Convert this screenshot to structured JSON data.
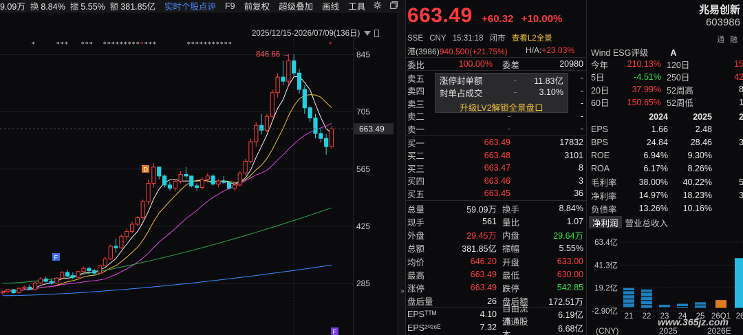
{
  "colors": {
    "up": "#ff3b3b",
    "down": "#2ee04a",
    "accent": "#f0c23a",
    "active_tab": "#4d8dff"
  },
  "toolbar": {
    "vol_text": "9.09万",
    "turnover_label": "换",
    "turnover_value": "8.84%",
    "amplitude_label": "振",
    "amplitude_value": "5.55%",
    "amount_label": "额",
    "amount_value": "381.85亿",
    "buttons": [
      "实时个股点评",
      "F9",
      "前复权",
      "超级叠加",
      "画线",
      "工具"
    ],
    "settings_icon": "gear-icon",
    "window_icon": "restore-window-icon"
  },
  "chart": {
    "date_range": "2025/12/15-2026/07/09(136日)",
    "peak_label": "846.66",
    "current_price_tag": "663.49",
    "y_ticks": [
      "845",
      "705",
      "565",
      "425",
      "285"
    ],
    "marker_D": "D",
    "marker_F": "F"
  },
  "chart_data": {
    "type": "candlestick",
    "y_ticks": [
      845,
      705,
      565,
      425,
      285
    ],
    "peak": 846.66,
    "last_close": 663.49,
    "series": [
      {
        "name": "K线",
        "ohlc": [
          [
            262,
            268,
            256,
            265
          ],
          [
            265,
            272,
            262,
            270
          ],
          [
            270,
            268,
            260,
            262
          ],
          [
            262,
            275,
            260,
            273
          ],
          [
            273,
            280,
            270,
            276
          ],
          [
            276,
            282,
            268,
            270
          ],
          [
            270,
            290,
            268,
            286
          ],
          [
            286,
            300,
            283,
            296
          ],
          [
            296,
            302,
            288,
            290
          ],
          [
            290,
            296,
            282,
            285
          ],
          [
            285,
            300,
            284,
            298
          ],
          [
            298,
            315,
            296,
            312
          ],
          [
            312,
            318,
            300,
            304
          ],
          [
            304,
            312,
            295,
            300
          ],
          [
            300,
            316,
            298,
            314
          ],
          [
            314,
            326,
            310,
            322
          ],
          [
            322,
            326,
            312,
            316
          ],
          [
            316,
            320,
            306,
            310
          ],
          [
            310,
            330,
            308,
            328
          ],
          [
            328,
            350,
            326,
            345
          ],
          [
            345,
            380,
            342,
            376
          ],
          [
            376,
            395,
            360,
            372
          ],
          [
            372,
            405,
            370,
            400
          ],
          [
            400,
            420,
            390,
            412
          ],
          [
            412,
            436,
            408,
            430
          ],
          [
            430,
            450,
            425,
            446
          ],
          [
            446,
            490,
            440,
            485
          ],
          [
            485,
            540,
            478,
            530
          ],
          [
            530,
            580,
            520,
            570
          ],
          [
            570,
            560,
            540,
            548
          ],
          [
            548,
            552,
            520,
            526
          ],
          [
            526,
            534,
            512,
            518
          ],
          [
            518,
            540,
            510,
            535
          ],
          [
            535,
            560,
            530,
            552
          ],
          [
            552,
            570,
            540,
            548
          ],
          [
            548,
            546,
            520,
            524
          ],
          [
            524,
            530,
            512,
            520
          ],
          [
            520,
            545,
            515,
            540
          ],
          [
            540,
            555,
            532,
            548
          ],
          [
            548,
            552,
            525,
            528
          ],
          [
            528,
            540,
            520,
            536
          ],
          [
            536,
            548,
            528,
            532
          ],
          [
            532,
            535,
            515,
            518
          ],
          [
            518,
            530,
            512,
            526
          ],
          [
            526,
            560,
            522,
            555
          ],
          [
            555,
            590,
            550,
            584
          ],
          [
            584,
            640,
            580,
            632
          ],
          [
            632,
            680,
            620,
            672
          ],
          [
            672,
            700,
            650,
            660
          ],
          [
            660,
            700,
            655,
            694
          ],
          [
            694,
            760,
            690,
            752
          ],
          [
            752,
            800,
            740,
            790
          ],
          [
            790,
            830,
            770,
            780
          ],
          [
            780,
            846.66,
            770,
            830
          ],
          [
            830,
            845,
            790,
            800
          ],
          [
            800,
            810,
            750,
            760
          ],
          [
            760,
            770,
            700,
            715
          ],
          [
            715,
            720,
            680,
            690
          ],
          [
            690,
            700,
            640,
            652
          ],
          [
            652,
            665,
            630,
            640
          ],
          [
            640,
            650,
            600,
            620
          ],
          [
            620,
            670,
            615,
            663.49
          ]
        ]
      }
    ]
  },
  "quote": {
    "price": "663.49",
    "change": "+60.32",
    "change_pct": "+10.00%",
    "market": "SSE",
    "currency": "CNY",
    "time": "15:31:18",
    "status": "闭市",
    "l2_link": "查看L2全景",
    "hk_line_left": "港(3986)",
    "hk_price": "940.500(+21.75%)",
    "ha_label": "H/A:",
    "ha_value": "+23.03%",
    "weibi_label": "委比",
    "weibi_value": "100.00%",
    "weicha_label": "委差",
    "weicha_value": "20980"
  },
  "sell_book": [
    {
      "label": "卖五",
      "price": "-",
      "vol": "-"
    },
    {
      "label": "卖四",
      "price": "-",
      "vol": "-"
    },
    {
      "label": "卖三",
      "price": "-",
      "vol": "-"
    },
    {
      "label": "卖二",
      "price": "-",
      "vol": "-"
    },
    {
      "label": "卖一",
      "price": "-",
      "vol": "-"
    }
  ],
  "buy_book": [
    {
      "label": "买一",
      "price": "663.49",
      "vol": "17832"
    },
    {
      "label": "买二",
      "price": "663.48",
      "vol": "3101"
    },
    {
      "label": "买三",
      "price": "663.47",
      "vol": "8"
    },
    {
      "label": "买四",
      "price": "663.46",
      "vol": "3"
    },
    {
      "label": "买五",
      "price": "663.45",
      "vol": "36"
    }
  ],
  "overlay": {
    "row1_label": "涨停封单额",
    "row1_dash": "-",
    "row1_value": "11.83亿",
    "row2_label": "封单占成交",
    "row2_dash": "-",
    "row2_value": "3.10%",
    "button": "升级LV2解锁全景盘口"
  },
  "stats": [
    {
      "l1": "总量",
      "v1": "59.09万",
      "c1": "white",
      "l2": "换手",
      "v2": "8.84%",
      "c2": "white"
    },
    {
      "l1": "现手",
      "v1": "561",
      "c1": "white",
      "l2": "量比",
      "v2": "1.07",
      "c2": "white"
    },
    {
      "l1": "外盘",
      "v1": "29.45万",
      "c1": "red",
      "l2": "内盘",
      "v2": "29.64万",
      "c2": "green"
    },
    {
      "l1": "总额",
      "v1": "381.85亿",
      "c1": "white",
      "l2": "振幅",
      "v2": "5.55%",
      "c2": "white"
    },
    {
      "l1": "均价",
      "v1": "646.20",
      "c1": "red",
      "l2": "开盘",
      "v2": "633.00",
      "c2": "red"
    },
    {
      "l1": "最高",
      "v1": "663.49",
      "c1": "red",
      "l2": "最低",
      "v2": "630.00",
      "c2": "red"
    },
    {
      "l1": "涨停",
      "v1": "663.49",
      "c1": "red",
      "l2": "跌停",
      "v2": "542.85",
      "c2": "green"
    },
    {
      "l1": "盘后量",
      "v1": "26",
      "c1": "white",
      "l2": "盘后额",
      "v2": "172.51万",
      "c2": "white"
    },
    {
      "l1": "EPSᵀᵀᴹ",
      "v1": "4.10",
      "c1": "white",
      "l2": "自由流通",
      "v2": "6.19亿",
      "c2": "white"
    },
    {
      "l1": "EPS²⁰²⁶ᴱ",
      "v1": "7.32",
      "c1": "white",
      "l2": "流通股本",
      "v2": "6.68亿",
      "c2": "white"
    }
  ],
  "right": {
    "name": "兆易创新",
    "code": "603986",
    "tags": [
      "通",
      "融"
    ],
    "esg_label": "Wind ESG评级",
    "esg_grade": "A",
    "perf": [
      {
        "l1": "今年",
        "v1": "210.13%",
        "c1": "red",
        "l2": "120日",
        "v2": "15",
        "c2": "red"
      },
      {
        "l1": "5日",
        "v1": "-4.51%",
        "c1": "green",
        "l2": "250日",
        "v2": "42",
        "c2": "red"
      },
      {
        "l1": "20日",
        "v1": "37.99%",
        "c1": "red",
        "l2": "52周高",
        "v2": "8",
        "c2": "white"
      },
      {
        "l1": "60日",
        "v1": "150.65%",
        "c1": "red",
        "l2": "52周低",
        "v2": "1",
        "c2": "white"
      }
    ],
    "fin_header": [
      "",
      "2024",
      "2025",
      "2"
    ],
    "fin": [
      [
        "EPS",
        "1.66",
        "2.48",
        ""
      ],
      [
        "BPS",
        "24.84",
        "28.46",
        "3"
      ],
      [
        "ROE",
        "6.94%",
        "9.30%",
        ""
      ],
      [
        "ROA",
        "6.17%",
        "8.26%",
        ""
      ],
      [
        "毛利率",
        "38.00%",
        "40.22%",
        "5"
      ],
      [
        "净利率",
        "14.97%",
        "18.23%",
        "3"
      ],
      [
        "负债率",
        "13.26%",
        "10.16%",
        ""
      ]
    ],
    "tabs": [
      "净利润",
      "营业总收入"
    ],
    "bar_y_ticks": [
      "63.4亿",
      "41.3亿",
      "19.2亿",
      "-2.90亿"
    ],
    "bar_x_labels": [
      "21",
      "22",
      "23",
      "24",
      "25",
      "26Q1",
      "26"
    ],
    "bar_values_yi": [
      19.2,
      17.8,
      3.0,
      4.0,
      5.5,
      7.6,
      48.0
    ],
    "bar_x_bottom": [
      "(CNY)",
      "2025",
      "2026E"
    ],
    "watermark": "www.365jz.com"
  }
}
